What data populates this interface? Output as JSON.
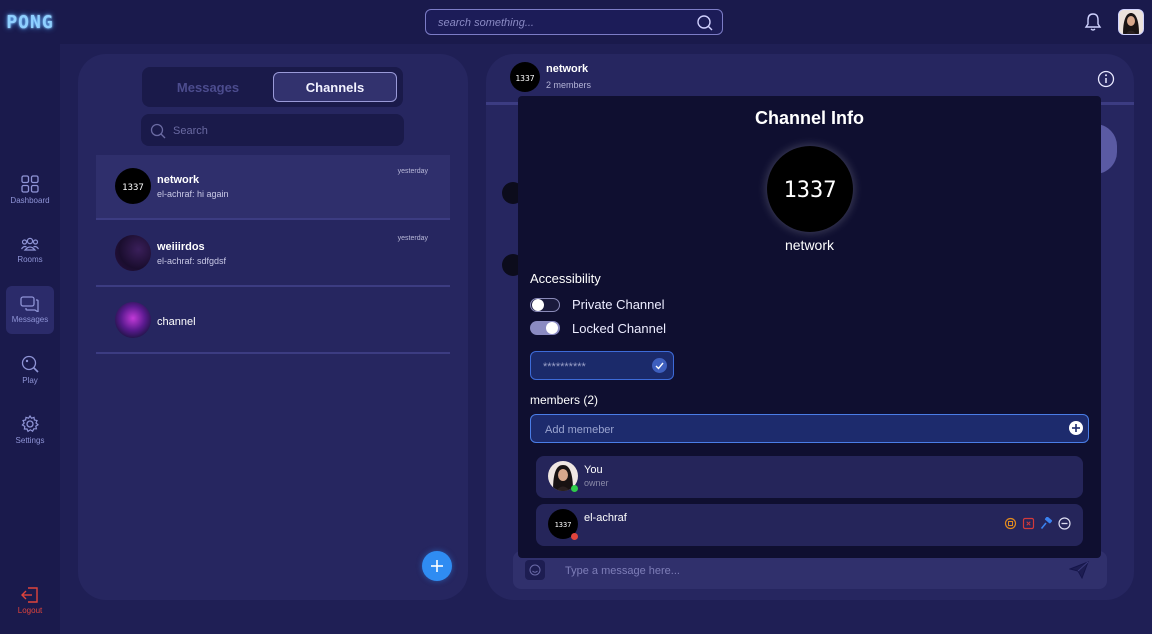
{
  "app": {
    "logo": "PONG"
  },
  "header": {
    "search_placeholder": "search something..."
  },
  "sidebar": {
    "items": [
      {
        "label": "Dashboard",
        "icon": "dashboard-icon"
      },
      {
        "label": "Rooms",
        "icon": "rooms-icon"
      },
      {
        "label": "Messages",
        "icon": "messages-icon",
        "active": true
      },
      {
        "label": "Play",
        "icon": "play-icon"
      },
      {
        "label": "Settings",
        "icon": "gear-icon"
      }
    ],
    "logout": "Logout"
  },
  "left": {
    "tabs": {
      "messages": "Messages",
      "channels": "Channels"
    },
    "search_placeholder": "Search",
    "conversations": [
      {
        "name": "network",
        "preview": "el-achraf: hi again",
        "time": "yesterday",
        "active": true
      },
      {
        "name": "weiiirdos",
        "preview": "el-achraf: sdfgdsf",
        "time": "yesterday"
      },
      {
        "name": "channel",
        "preview": "",
        "time": ""
      }
    ]
  },
  "chat": {
    "name": "network",
    "members": "2 members",
    "input_placeholder": "Type a message here..."
  },
  "channel_info": {
    "title": "Channel Info",
    "avatar_text": "1337",
    "name": "network",
    "accessibility": "Accessibility",
    "private_label": "Private Channel",
    "private_on": false,
    "locked_label": "Locked Channel",
    "locked_on": true,
    "password_placeholder": "**********",
    "members_label": "members (2)",
    "add_placeholder": "Add memeber",
    "members": [
      {
        "name": "You",
        "role": "owner",
        "status_color": "#2ecc4a"
      },
      {
        "name": "el-achraf",
        "role": "",
        "status_color": "#e0443c"
      }
    ]
  }
}
